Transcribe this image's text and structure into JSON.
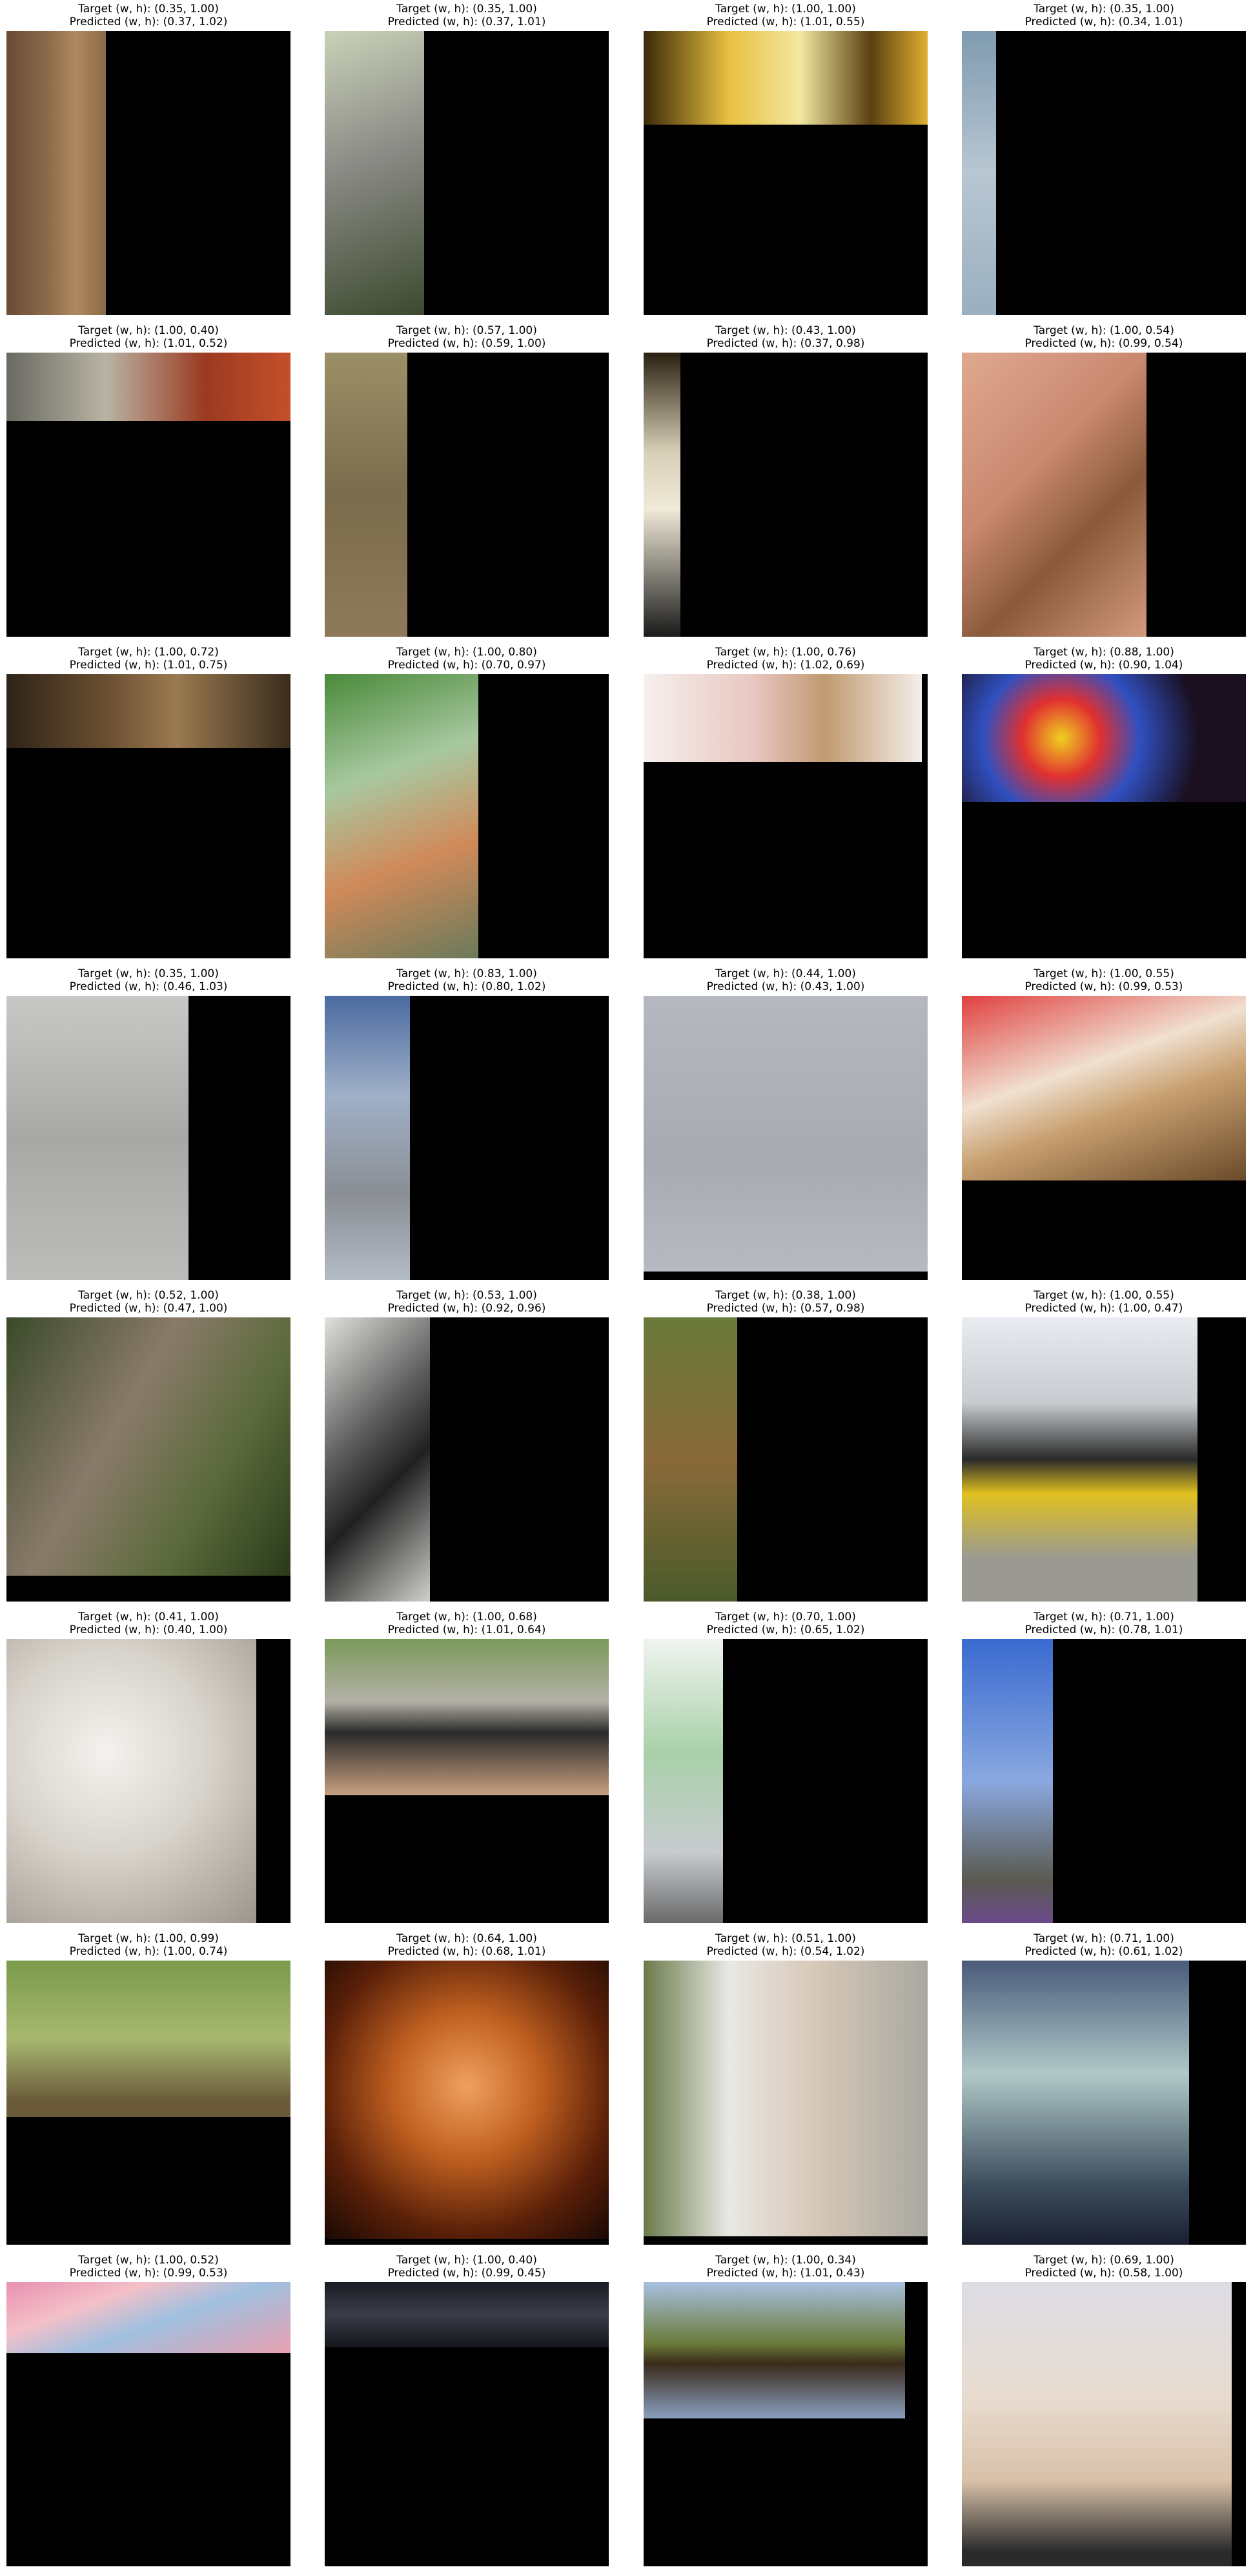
{
  "panels": [
    {
      "target": "Target (w, h): (0.35, 1.00)",
      "predicted": "Predicted (w, h): (0.37, 1.02)",
      "w": 0.35,
      "h": 1.0,
      "bg": "linear-gradient(90deg,#6b4a35 0%,#8a6a4a 40%,#b08860 70%,#8c6a48 100%)",
      "icon": "totem-mask-image"
    },
    {
      "target": "Target (w, h): (0.35, 1.00)",
      "predicted": "Predicted (w, h): (0.37, 1.01)",
      "w": 0.35,
      "h": 1.0,
      "bg": "linear-gradient(160deg,#c9d2b8 0%,#8b8b86 45%,#3c4a2e 100%)",
      "icon": "husky-dog-image"
    },
    {
      "target": "Target (w, h): (1.00, 1.00)",
      "predicted": "Predicted (w, h): (1.01, 0.55)",
      "w": 1.0,
      "h": 0.33,
      "bg": "linear-gradient(90deg,#3a2a08 0%,#e8c040 30%,#f2e8a0 55%,#5a4010 80%,#e0b030 100%)",
      "icon": "person-in-sunlight-image"
    },
    {
      "target": "Target (w, h): (0.35, 1.00)",
      "predicted": "Predicted (w, h): (0.34, 1.01)",
      "w": 0.12,
      "h": 1.0,
      "bg": "linear-gradient(180deg,#7f9bb0 0%,#b8c6d2 50%,#9aafbf 100%)",
      "icon": "airplane-tail-image"
    },
    {
      "target": "Target (w, h): (1.00, 0.40)",
      "predicted": "Predicted (w, h): (1.01, 0.52)",
      "w": 1.0,
      "h": 0.24,
      "bg": "linear-gradient(90deg,#6a6a62 0%,#b8b4a4 35%,#9b3a20 70%,#c4502a 100%)",
      "icon": "library-shelves-image"
    },
    {
      "target": "Target (w, h): (0.57, 1.00)",
      "predicted": "Predicted (w, h): (0.59, 1.00)",
      "w": 0.29,
      "h": 1.0,
      "bg": "linear-gradient(180deg,#9c9068 0%,#7a6c4c 50%,#8e7a5a 100%)",
      "icon": "badger-image"
    },
    {
      "target": "Target (w, h): (0.43, 1.00)",
      "predicted": "Predicted (w, h): (0.37, 0.98)",
      "w": 0.13,
      "h": 1.0,
      "bg": "linear-gradient(180deg,#2a2010 0%,#d8cfb8 35%,#f0ead8 55%,#1a1a1a 100%)",
      "icon": "glass-bottle-image"
    },
    {
      "target": "Target (w, h): (1.00, 0.54)",
      "predicted": "Predicted (w, h): (0.99, 0.54)",
      "w": 0.65,
      "h": 1.0,
      "bg": "linear-gradient(135deg,#e0a890 0%,#c98870 40%,#8a5a3a 65%,#d49a80 100%)",
      "icon": "frog-on-hand-image"
    },
    {
      "target": "Target (w, h): (1.00, 0.72)",
      "predicted": "Predicted (w, h): (1.01, 0.75)",
      "w": 1.0,
      "h": 0.26,
      "bg": "linear-gradient(90deg,#2e2418 0%,#6a4e30 35%,#9a7a50 60%,#3a2c1c 100%)",
      "icon": "dog-fur-image"
    },
    {
      "target": "Target (w, h): (1.00, 0.80)",
      "predicted": "Predicted (w, h): (0.70, 0.97)",
      "w": 0.54,
      "h": 1.0,
      "bg": "linear-gradient(160deg,#4a8a3a 0%,#a8c8a0 35%,#d08a5a 65%,#6a7a5a 100%)",
      "icon": "bridge-railing-image"
    },
    {
      "target": "Target (w, h): (1.00, 0.76)",
      "predicted": "Predicted (w, h): (1.02, 0.69)",
      "w": 0.98,
      "h": 0.31,
      "bg": "linear-gradient(90deg,#f6f0ee 0%,#e8c6c0 40%,#c09a70 65%,#f4eeea 100%)",
      "icon": "makeup-brush-image"
    },
    {
      "target": "Target (w, h): (0.88, 1.00)",
      "predicted": "Predicted (w, h): (0.90, 1.04)",
      "w": 1.0,
      "h": 0.45,
      "bg": "radial-gradient(circle at 35% 50%,#f0d020 0%,#e03030 20%,#3050c0 40%,#1a1020 70%)",
      "icon": "casino-wheel-image"
    },
    {
      "target": "Target (w, h): (0.35, 1.00)",
      "predicted": "Predicted (w, h): (0.46, 1.03)",
      "w": 0.64,
      "h": 1.0,
      "bg": "linear-gradient(180deg,#c8c8c6 0%,#a8a8a6 50%,#bcbcba 100%)",
      "icon": "green-beetle-image"
    },
    {
      "target": "Target (w, h): (0.83, 1.00)",
      "predicted": "Predicted (w, h): (0.80, 1.02)",
      "w": 0.3,
      "h": 1.0,
      "bg": "linear-gradient(180deg,#4a6aa0 0%,#a0b0c8 35%,#8a8e94 70%,#b4bcc6 100%)",
      "icon": "airliner-image"
    },
    {
      "target": "Target (w, h): (0.44, 1.00)",
      "predicted": "Predicted (w, h): (0.43, 1.00)",
      "w": 1.0,
      "h": 0.97,
      "bg": "linear-gradient(180deg,#b6b8c0 0%,#a8aab2 60%,#b8bac2 100%)",
      "icon": "screws-image"
    },
    {
      "target": "Target (w, h): (1.00, 0.55)",
      "predicted": "Predicted (w, h): (0.99, 0.53)",
      "w": 1.0,
      "h": 0.65,
      "bg": "linear-gradient(160deg,#e04040 0%,#f0e0d0 40%,#c8a070 60%,#6a4a2a 100%)",
      "icon": "strawberry-dessert-image"
    },
    {
      "target": "Target (w, h): (0.52, 1.00)",
      "predicted": "Predicted (w, h): (0.47, 1.00)",
      "w": 1.0,
      "h": 0.91,
      "bg": "linear-gradient(120deg,#3a4a2a 0%,#8a7a6a 40%,#5a6a3a 70%,#2a3a1a 100%)",
      "icon": "monkey-in-branches-image"
    },
    {
      "target": "Target (w, h): (0.53, 1.00)",
      "predicted": "Predicted (w, h): (0.92, 0.96)",
      "w": 0.37,
      "h": 1.0,
      "bg": "linear-gradient(135deg,#e0e0dc 0%,#5a5a5a 40%,#202020 60%,#d0d0cc 100%)",
      "icon": "headphones-image"
    },
    {
      "target": "Target (w, h): (0.38, 1.00)",
      "predicted": "Predicted (w, h): (0.57, 0.98)",
      "w": 0.33,
      "h": 1.0,
      "bg": "linear-gradient(180deg,#6a7a3a 0%,#8a6a3a 50%,#4a5a2a 100%)",
      "icon": "bird-in-grass-image"
    },
    {
      "target": "Target (w, h): (1.00, 0.55)",
      "predicted": "Predicted (w, h): (1.00, 0.47)",
      "w": 0.83,
      "h": 1.0,
      "bg": "linear-gradient(180deg,#e8ecf0 0%,#c8ccd0 30%,#2a2a2a 50%,#e0c020 62%,#9a9a92 85%)",
      "icon": "train-locomotive-image"
    },
    {
      "target": "Target (w, h): (0.41, 1.00)",
      "predicted": "Predicted (w, h): (0.40, 1.00)",
      "w": 0.88,
      "h": 1.0,
      "bg": "radial-gradient(circle at 40% 40%,#f4f2ee 0%,#d8d4cc 45%,#9a968e 100%)",
      "icon": "white-dog-face-image"
    },
    {
      "target": "Target (w, h): (1.00, 0.68)",
      "predicted": "Predicted (w, h): (1.01, 0.64)",
      "w": 1.0,
      "h": 0.55,
      "bg": "linear-gradient(180deg,#7a9a5a 0%,#b4b0a6 40%,#2a2a2a 60%,#c8a080 100%)",
      "icon": "man-with-dog-image"
    },
    {
      "target": "Target (w, h): (0.70, 1.00)",
      "predicted": "Predicted (w, h): (0.65, 1.02)",
      "w": 0.28,
      "h": 1.0,
      "bg": "linear-gradient(180deg,#f0f4f0 0%,#a8d0a8 40%,#c8ccd0 75%,#6a6a6a 100%)",
      "icon": "clothes-iron-image"
    },
    {
      "target": "Target (w, h): (0.71, 1.00)",
      "predicted": "Predicted (w, h): (0.78, 1.01)",
      "w": 0.32,
      "h": 1.0,
      "bg": "linear-gradient(180deg,#3a6ad0 0%,#8aa8e0 50%,#5a5a50 85%,#6a4a8a 100%)",
      "icon": "street-lamp-image"
    },
    {
      "target": "Target (w, h): (1.00, 0.99)",
      "predicted": "Predicted (w, h): (1.00, 0.74)",
      "w": 1.0,
      "h": 0.55,
      "bg": "linear-gradient(180deg,#7a9a4a 0%,#a8b870 50%,#6a5a3a 90%)",
      "icon": "crested-bird-image"
    },
    {
      "target": "Target (w, h): (0.64, 1.00)",
      "predicted": "Predicted (w, h): (0.68, 1.01)",
      "w": 1.0,
      "h": 0.98,
      "bg": "radial-gradient(circle at 50% 45%,#f0a060 0%,#c06020 35%,#5a2008 70%,#1a0804 100%)",
      "icon": "insect-in-hands-image"
    },
    {
      "target": "Target (w, h): (0.51, 1.00)",
      "predicted": "Predicted (w, h): (0.54, 1.02)",
      "w": 1.0,
      "h": 0.97,
      "bg": "linear-gradient(90deg,#6a7a4a 0%,#e8e8e4 30%,#d8c8b8 60%,#a8a8a0 100%)",
      "icon": "dog-and-elder-image"
    },
    {
      "target": "Target (w, h): (0.71, 1.00)",
      "predicted": "Predicted (w, h): (0.61, 1.02)",
      "w": 0.8,
      "h": 1.0,
      "bg": "linear-gradient(180deg,#4a5a7a 0%,#b0c8c8 40%,#3a4a5a 80%,#1a2030 100%)",
      "icon": "teapot-set-image"
    },
    {
      "target": "Target (w, h): (1.00, 0.52)",
      "predicted": "Predicted (w, h): (0.99, 0.53)",
      "w": 1.0,
      "h": 0.25,
      "bg": "linear-gradient(160deg,#e890b0 0%,#f4c0c8 30%,#a0c0e0 55%,#e8a0b0 100%)",
      "icon": "colorful-fabric-image"
    },
    {
      "target": "Target (w, h): (1.00, 0.40)",
      "predicted": "Predicted (w, h): (0.99, 0.45)",
      "w": 1.0,
      "h": 0.23,
      "bg": "linear-gradient(180deg,#1a1c24 0%,#3a3c48 50%,#14161c 100%)",
      "icon": "dark-structure-image"
    },
    {
      "target": "Target (w, h): (1.00, 0.34)",
      "predicted": "Predicted (w, h): (1.01, 0.43)",
      "w": 0.92,
      "h": 0.48,
      "bg": "linear-gradient(180deg,#a8c0e0 0%,#6a7a3a 45%,#3a2a1a 60%,#8aa0c0 100%)",
      "icon": "bird-on-branch-image"
    },
    {
      "target": "Target (w, h): (0.69, 1.00)",
      "predicted": "Predicted (w, h): (0.58, 1.00)",
      "w": 0.95,
      "h": 1.0,
      "bg": "linear-gradient(180deg,#dcdce4 0%,#e8dcd0 40%,#d8c0a8 70%,#2a2a2a 95%)",
      "icon": "poodle-image"
    }
  ]
}
